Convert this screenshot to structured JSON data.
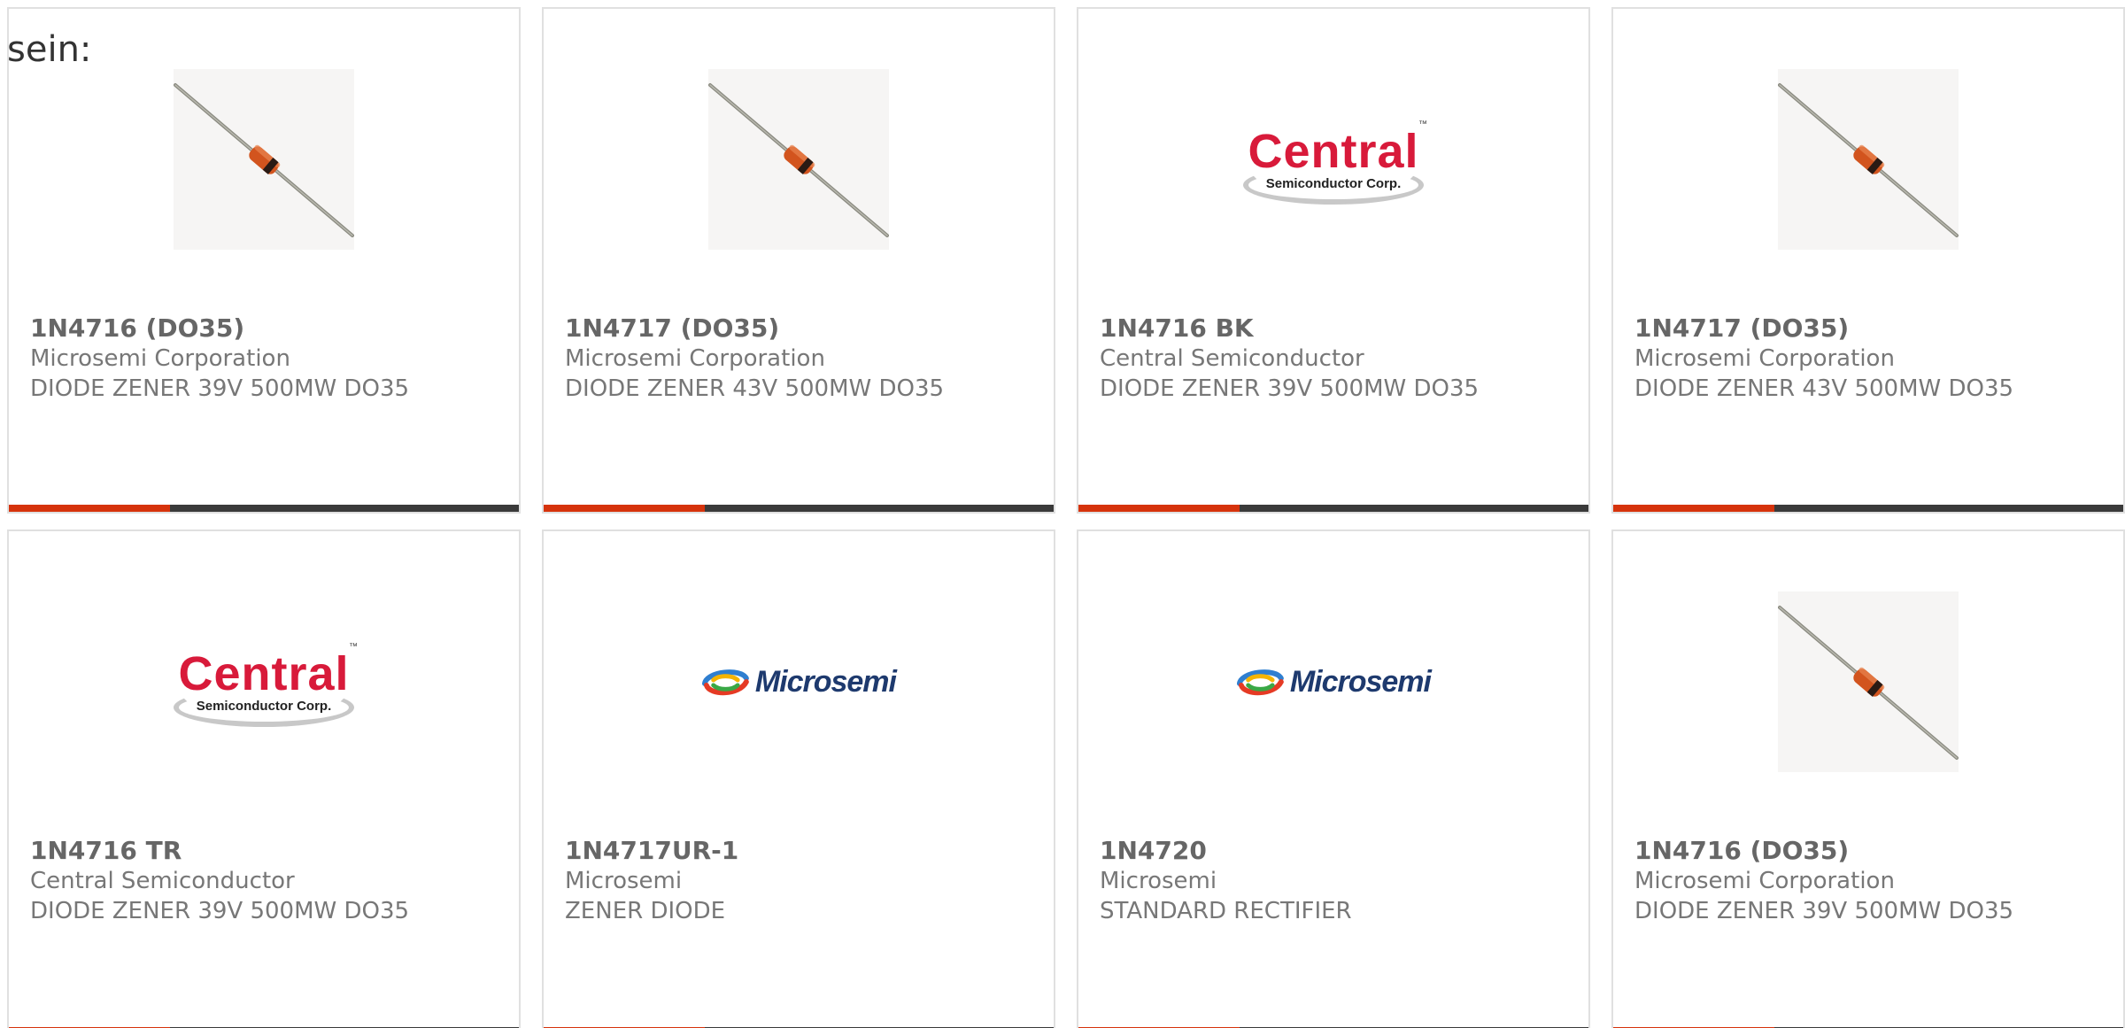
{
  "intro_text": "sein:",
  "colors": {
    "accent": "#d6330c",
    "bar": "#3a3a3a",
    "central_red": "#d81a3a",
    "microsemi_blue": "#1e3a6e"
  },
  "cards": [
    {
      "part": "1N4716 (DO35)",
      "manufacturer": "Microsemi Corporation",
      "description": "DIODE ZENER 39V 500MW DO35",
      "image": "diode-photo"
    },
    {
      "part": "1N4717 (DO35)",
      "manufacturer": "Microsemi Corporation",
      "description": "DIODE ZENER 43V 500MW DO35",
      "image": "diode-photo"
    },
    {
      "part": "1N4716 BK",
      "manufacturer": "Central Semiconductor",
      "description": "DIODE ZENER 39V 500MW DO35",
      "image": "central-logo",
      "logo_word": "Central",
      "logo_sub": "Semiconductor Corp.",
      "logo_tm": "™"
    },
    {
      "part": "1N4717 (DO35)",
      "manufacturer": "Microsemi Corporation",
      "description": "DIODE ZENER 43V 500MW DO35",
      "image": "diode-photo"
    },
    {
      "part": "1N4716 TR",
      "manufacturer": "Central Semiconductor",
      "description": "DIODE ZENER 39V 500MW DO35",
      "image": "central-logo",
      "logo_word": "Central",
      "logo_sub": "Semiconductor Corp.",
      "logo_tm": "™"
    },
    {
      "part": "1N4717UR-1",
      "manufacturer": "Microsemi",
      "description": "ZENER DIODE",
      "image": "microsemi-logo",
      "logo_word": "Microsemi"
    },
    {
      "part": "1N4720",
      "manufacturer": "Microsemi",
      "description": "STANDARD RECTIFIER",
      "image": "microsemi-logo",
      "logo_word": "Microsemi"
    },
    {
      "part": "1N4716 (DO35)",
      "manufacturer": "Microsemi Corporation",
      "description": "DIODE ZENER 39V 500MW DO35",
      "image": "diode-photo"
    }
  ]
}
